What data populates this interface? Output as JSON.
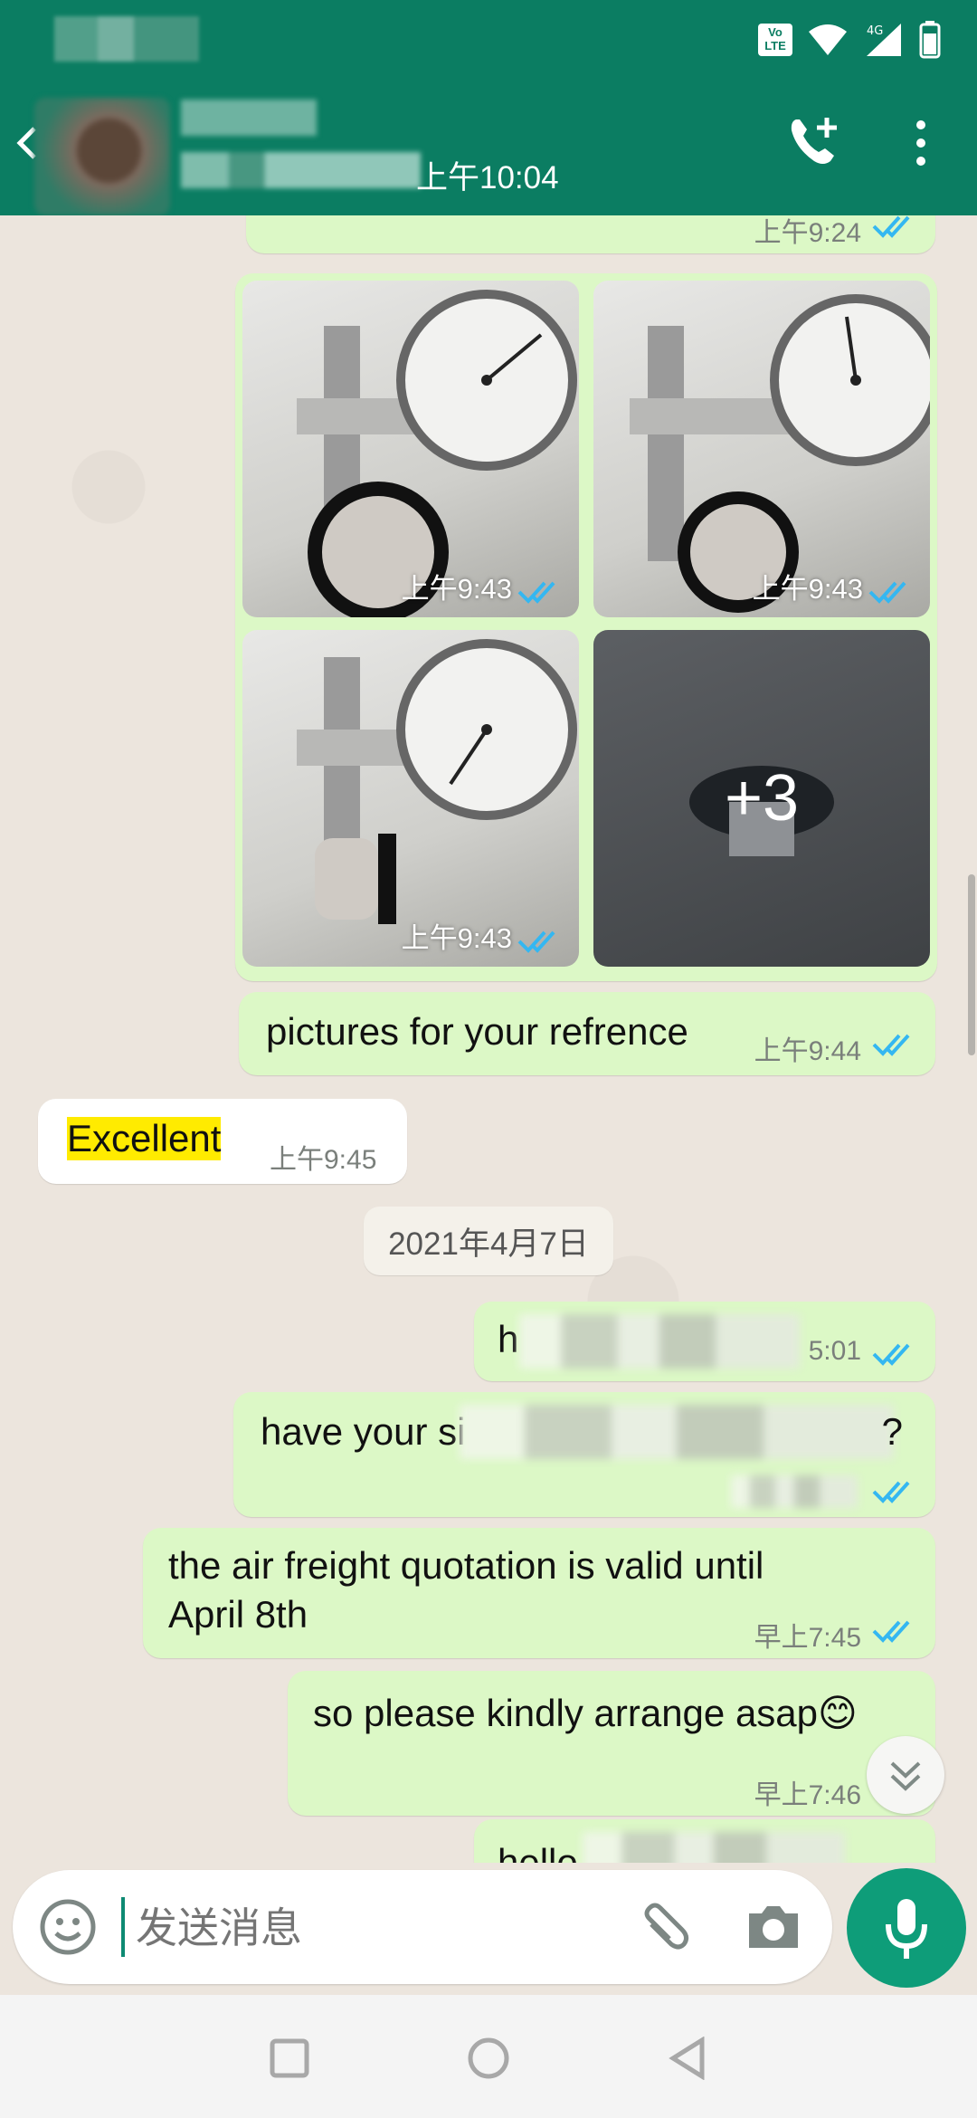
{
  "status_bar": {
    "volte_label": "Vo\nLTE",
    "network_label": "4G"
  },
  "header": {
    "last_seen_time": "上午10:04"
  },
  "messages": [
    {
      "id": "m0",
      "time": "上午9:24"
    },
    {
      "id": "photos",
      "items": [
        {
          "time": "上午9:43"
        },
        {
          "time": "上午9:43"
        },
        {
          "time": "上午9:43"
        },
        {
          "more": "+3"
        }
      ]
    },
    {
      "id": "m1",
      "text": "pictures for your refrence",
      "time": "上午9:44"
    },
    {
      "id": "m2",
      "text": "Excellent",
      "time": "上午9:45"
    },
    {
      "id": "m3",
      "text": "h",
      "time": "5:01"
    },
    {
      "id": "m4",
      "text_start": "have your si",
      "text_end": "?"
    },
    {
      "id": "m5",
      "text_line1": "the air freight quotation is valid until",
      "text_line2": "April 8th",
      "time": "早上7:45"
    },
    {
      "id": "m6",
      "text": "so please kindly arrange asap😊",
      "time": "早上7:46"
    },
    {
      "id": "m7",
      "text": "hello"
    }
  ],
  "date_separator": "2021年4月7日",
  "composer": {
    "placeholder": "发送消息"
  },
  "colors": {
    "header": "#0b7d62",
    "outgoing": "#dcf8c6",
    "ticks": "#34b7f1",
    "mic": "#0e9d79"
  },
  "icons": [
    "back-icon",
    "add-call-icon",
    "more-vert-icon",
    "emoji-icon",
    "attach-icon",
    "camera-icon",
    "mic-icon",
    "scroll-down-icon",
    "recent-apps-icon",
    "home-icon",
    "back-nav-icon"
  ]
}
